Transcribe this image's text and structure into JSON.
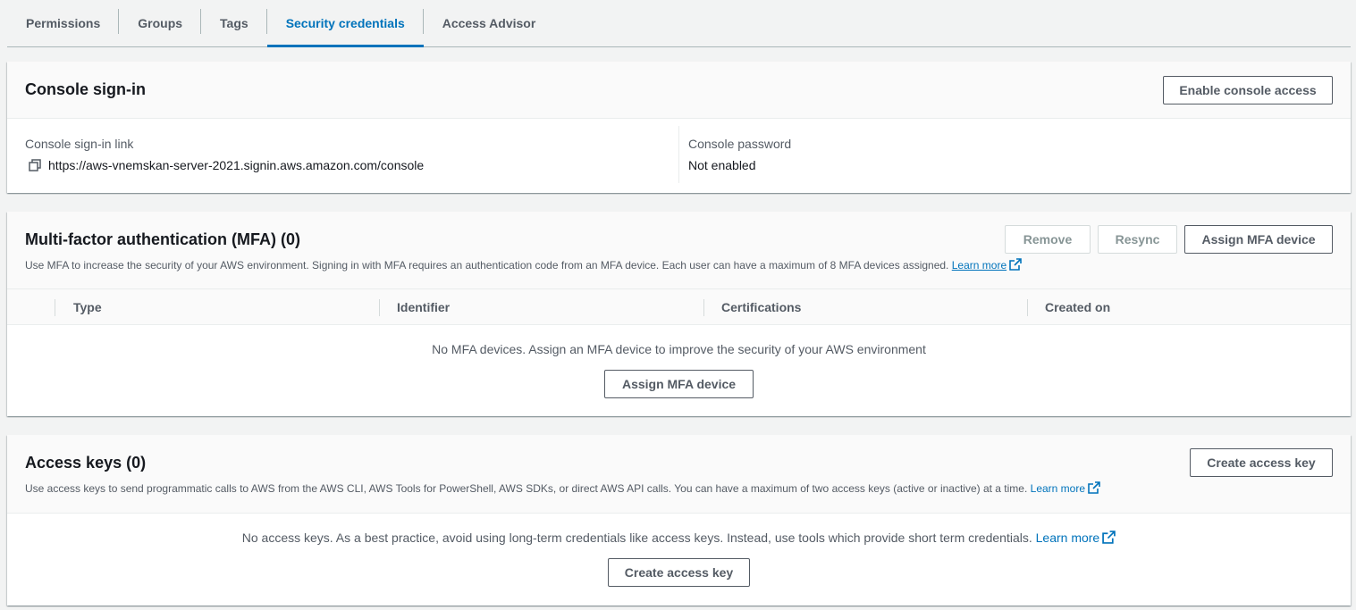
{
  "tabs": [
    {
      "label": "Permissions",
      "active": false
    },
    {
      "label": "Groups",
      "active": false
    },
    {
      "label": "Tags",
      "active": false
    },
    {
      "label": "Security credentials",
      "active": true
    },
    {
      "label": "Access Advisor",
      "active": false
    }
  ],
  "console_signin": {
    "title": "Console sign-in",
    "enable_button": "Enable console access",
    "link_label": "Console sign-in link",
    "link_value": "https://aws-vnemskan-server-2021.signin.aws.amazon.com/console",
    "password_label": "Console password",
    "password_value": "Not enabled"
  },
  "mfa": {
    "title": "Multi-factor authentication (MFA) (0)",
    "description": "Use MFA to increase the security of your AWS environment. Signing in with MFA requires an authentication code from an MFA device. Each user can have a maximum of 8 MFA devices assigned.",
    "learn_more": "Learn more",
    "remove_button": "Remove",
    "resync_button": "Resync",
    "assign_button": "Assign MFA device",
    "columns": [
      "Type",
      "Identifier",
      "Certifications",
      "Created on"
    ],
    "empty_message": "No MFA devices. Assign an MFA device to improve the security of your AWS environment",
    "empty_assign_button": "Assign MFA device"
  },
  "access_keys": {
    "title": "Access keys (0)",
    "description": "Use access keys to send programmatic calls to AWS from the AWS CLI, AWS Tools for PowerShell, AWS SDKs, or direct AWS API calls. You can have a maximum of two access keys (active or inactive) at a time.",
    "learn_more": "Learn more",
    "create_button": "Create access key",
    "empty_message": "No access keys. As a best practice, avoid using long-term credentials like access keys. Instead, use tools which provide short term credentials.",
    "empty_learn_more": "Learn more",
    "empty_create_button": "Create access key"
  },
  "colors": {
    "accent": "#0073bb",
    "text": "#16191f",
    "muted": "#545b64",
    "background": "#f2f3f3"
  },
  "icons": {
    "copy": "copy-icon",
    "external_link": "external-link-icon"
  }
}
